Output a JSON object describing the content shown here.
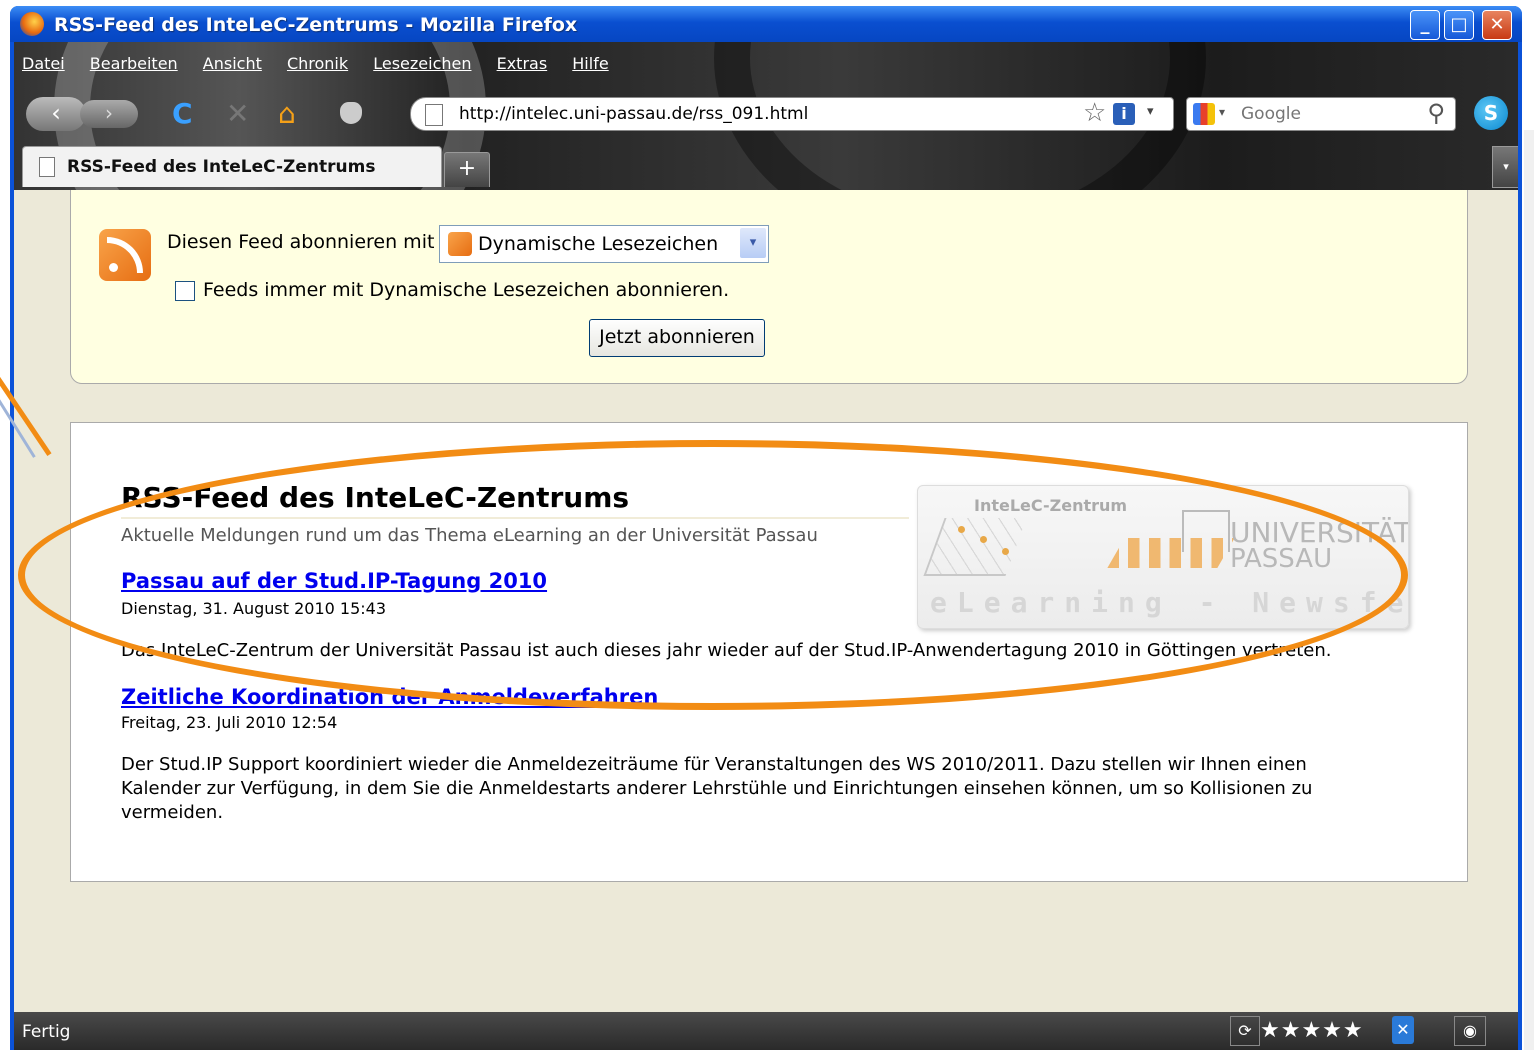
{
  "window": {
    "title": "RSS-Feed des InteLeC-Zentrums - Mozilla Firefox",
    "minimize_label": "_",
    "maximize_label": "□",
    "close_label": "✕"
  },
  "menu": {
    "items": [
      "Datei",
      "Bearbeiten",
      "Ansicht",
      "Chronik",
      "Lesezeichen",
      "Extras",
      "Hilfe"
    ]
  },
  "toolbar": {
    "back_glyph": "‹",
    "forward_glyph": "›",
    "reload_glyph": "C",
    "stop_glyph": "✕",
    "home_glyph": "⌂",
    "url": "http://intelec.uni-passau.de/rss_091.html",
    "bookmark_star_glyph": "☆",
    "info_glyph": "i",
    "dropdown_glyph": "▾",
    "search_placeholder": "Google",
    "search_glyph": "⚲",
    "skype_glyph": "S"
  },
  "tabs": {
    "active_tab_label": "RSS-Feed des InteLeC-Zentrums",
    "new_tab_label": "+",
    "tab_list_glyph": "▾"
  },
  "subscribe": {
    "label": "Diesen Feed abonnieren mit",
    "reader_selected": "Dynamische Lesezeichen",
    "select_arrow": "▾",
    "checkbox_label": "Feeds immer mit Dynamische Lesezeichen abonnieren.",
    "checkbox_checked": false,
    "button_label": "Jetzt abonnieren"
  },
  "feed": {
    "title": "RSS-Feed des InteLeC-Zentrums",
    "subtitle": "Aktuelle Meldungen rund um das Thema eLearning an der Universität Passau",
    "logo": {
      "line1": "InteLeC-Zentrum",
      "line2": "UNIVERSITÄT",
      "line3": "PASSAU",
      "line4": "eLearning - Newsfeed"
    },
    "items": [
      {
        "title": "Passau auf der Stud.IP-Tagung 2010",
        "date": "Dienstag, 31. August 2010 15:43",
        "body": "Das InteLeC-Zentrum der Universität Passau ist auch dieses jahr wieder auf der Stud.IP-Anwendertagung 2010 in Göttingen vertreten."
      },
      {
        "title": "Zeitliche Koordination der Anmeldeverfahren",
        "date": "Freitag, 23. Juli 2010 12:54",
        "body": "Der Stud.IP Support koordiniert wieder die Anmeldezeiträume für Veranstaltungen des WS 2010/2011. Dazu stellen wir Ihnen einen Kalender zur Verfügung, in dem Sie die Anmeldestarts anderer Lehrstühle und Einrichtungen einsehen können, um so Kollisionen zu vermeiden."
      }
    ]
  },
  "status": {
    "text": "Fertig",
    "rating_stars": "★★★★★",
    "rating_value": 5
  },
  "colors": {
    "annotation_accent": "#f28c14",
    "link": "#0000ee",
    "titlebar_blue": "#0a4fd0",
    "subscribe_bg": "#ffffe1"
  }
}
